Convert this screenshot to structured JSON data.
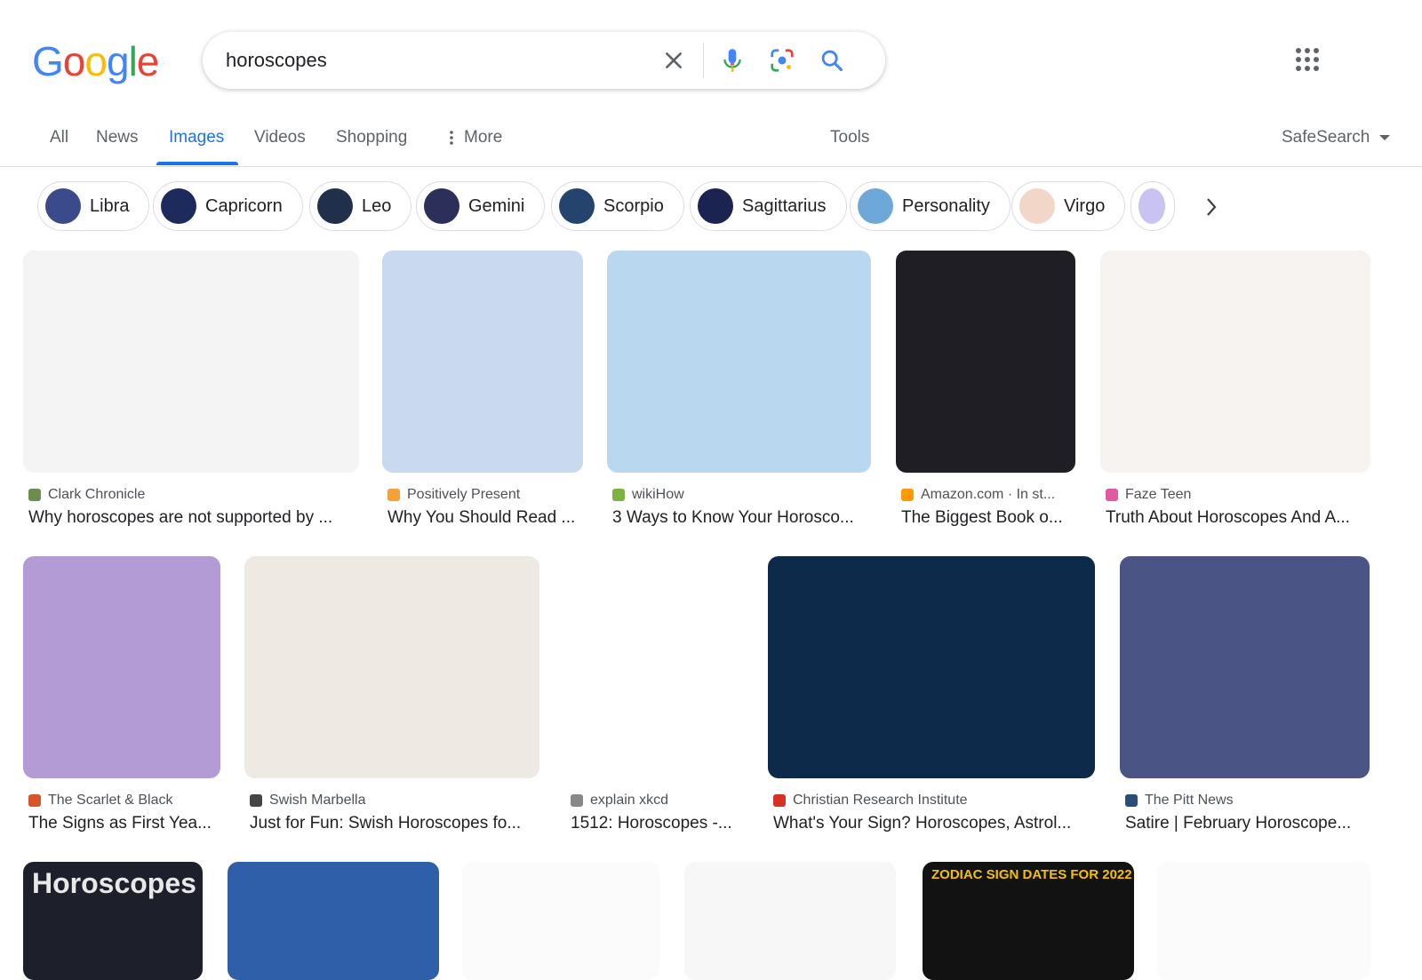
{
  "logo": {
    "letters": [
      "G",
      "o",
      "o",
      "g",
      "l",
      "e"
    ],
    "colors": [
      "#4285F4",
      "#EA4335",
      "#FBBC05",
      "#4285F4",
      "#34A853",
      "#EA4335"
    ]
  },
  "search": {
    "query": "horoscopes"
  },
  "icons": {
    "clear": "close-icon",
    "voice": "microphone-icon",
    "lens": "camera-lens-icon",
    "search": "search-icon",
    "apps": "apps-grid-icon"
  },
  "tabs": {
    "all": "All",
    "news": "News",
    "images": "Images",
    "videos": "Videos",
    "shopping": "Shopping",
    "more": "More",
    "tools": "Tools",
    "safesearch": "SafeSearch"
  },
  "chips": [
    {
      "label": "Libra",
      "color": "#3a4a8a"
    },
    {
      "label": "Capricorn",
      "color": "#1d2a5c"
    },
    {
      "label": "Leo",
      "color": "#20304a"
    },
    {
      "label": "Gemini",
      "color": "#2b2f5a"
    },
    {
      "label": "Scorpio",
      "color": "#24446e"
    },
    {
      "label": "Sagittarius",
      "color": "#1b2350"
    },
    {
      "label": "Personality",
      "color": "#6ea8d8"
    },
    {
      "label": "Virgo",
      "color": "#f2d6c8"
    }
  ],
  "results_row1": [
    {
      "source": "Clark Chronicle",
      "title": "Why horoscopes are not supported by ...",
      "fav_color": "#6b8e4e",
      "bg": "#f4f4f4"
    },
    {
      "source": "Positively Present",
      "title": "Why You Should Read ...",
      "fav_color": "#f4a13a",
      "bg": "#c8d9f0"
    },
    {
      "source": "wikiHow",
      "title": "3 Ways to Know Your Horosco...",
      "fav_color": "#7cb342",
      "bg": "#b9d8f0"
    },
    {
      "source": "Amazon.com · In st...",
      "title": "The Biggest Book o...",
      "fav_color": "#ff9900",
      "bg": "#1e1e24"
    },
    {
      "source": "Faze Teen",
      "title": "Truth About Horoscopes And A...",
      "fav_color": "#e05aa0",
      "bg": "#f6f3f0"
    }
  ],
  "results_row2": [
    {
      "source": "The Scarlet & Black",
      "title": "The Signs as First Yea...",
      "fav_color": "#d9542b",
      "bg": "#b39bd6"
    },
    {
      "source": "Swish Marbella",
      "title": "Just for Fun: Swish Horoscopes fo...",
      "fav_color": "#444444",
      "bg": "#efe9e4"
    },
    {
      "source": "explain xkcd",
      "title": "1512: Horoscopes -...",
      "fav_color": "#888888",
      "bg": "#ffffff"
    },
    {
      "source": "Christian Research Institute",
      "title": "What's Your Sign? Horoscopes, Astrol...",
      "fav_color": "#d93025",
      "bg": "#0d2a4a"
    },
    {
      "source": "The Pitt News",
      "title": "Satire | February Horoscope...",
      "fav_color": "#2a4d7a",
      "bg": "#4b5585"
    }
  ],
  "results_row3": [
    {
      "heading": "Horoscopes",
      "bg": "#1d1f2a"
    },
    {
      "heading": "",
      "bg": "#2f5fa8"
    },
    {
      "heading": "",
      "bg": "#fbfbfb"
    },
    {
      "heading": "",
      "bg": "#f7f7f7"
    },
    {
      "heading": "ZODIAC SIGN DATES FOR 2022",
      "bg": "#121212"
    },
    {
      "heading": "",
      "bg": "#fbfbfb"
    }
  ]
}
